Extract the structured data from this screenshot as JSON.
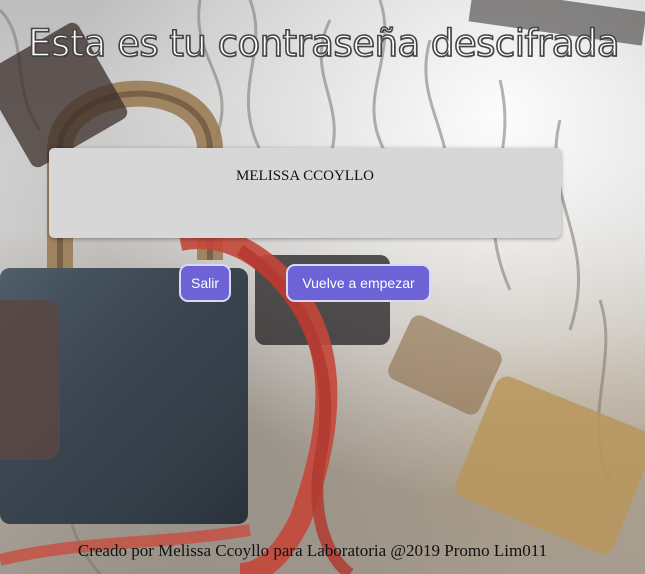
{
  "page": {
    "title": "Esta es tu contraseña descifrada"
  },
  "result": {
    "text": "MELISSA CCOYLLO"
  },
  "actions": {
    "exit_label": "Salir",
    "restart_label": "Vuelve a empezar"
  },
  "footer": {
    "text": "Creado por Melissa Ccoyllo para Laboratoria @2019 Promo Lim011"
  },
  "colors": {
    "button_bg": "#6e63d6",
    "button_border": "#d9d9f5",
    "panel_bg": "#d7d7d7",
    "title_fill": "#ffffff",
    "title_outline": "#444444"
  },
  "background": {
    "description_icon": "padlocks-photo"
  }
}
